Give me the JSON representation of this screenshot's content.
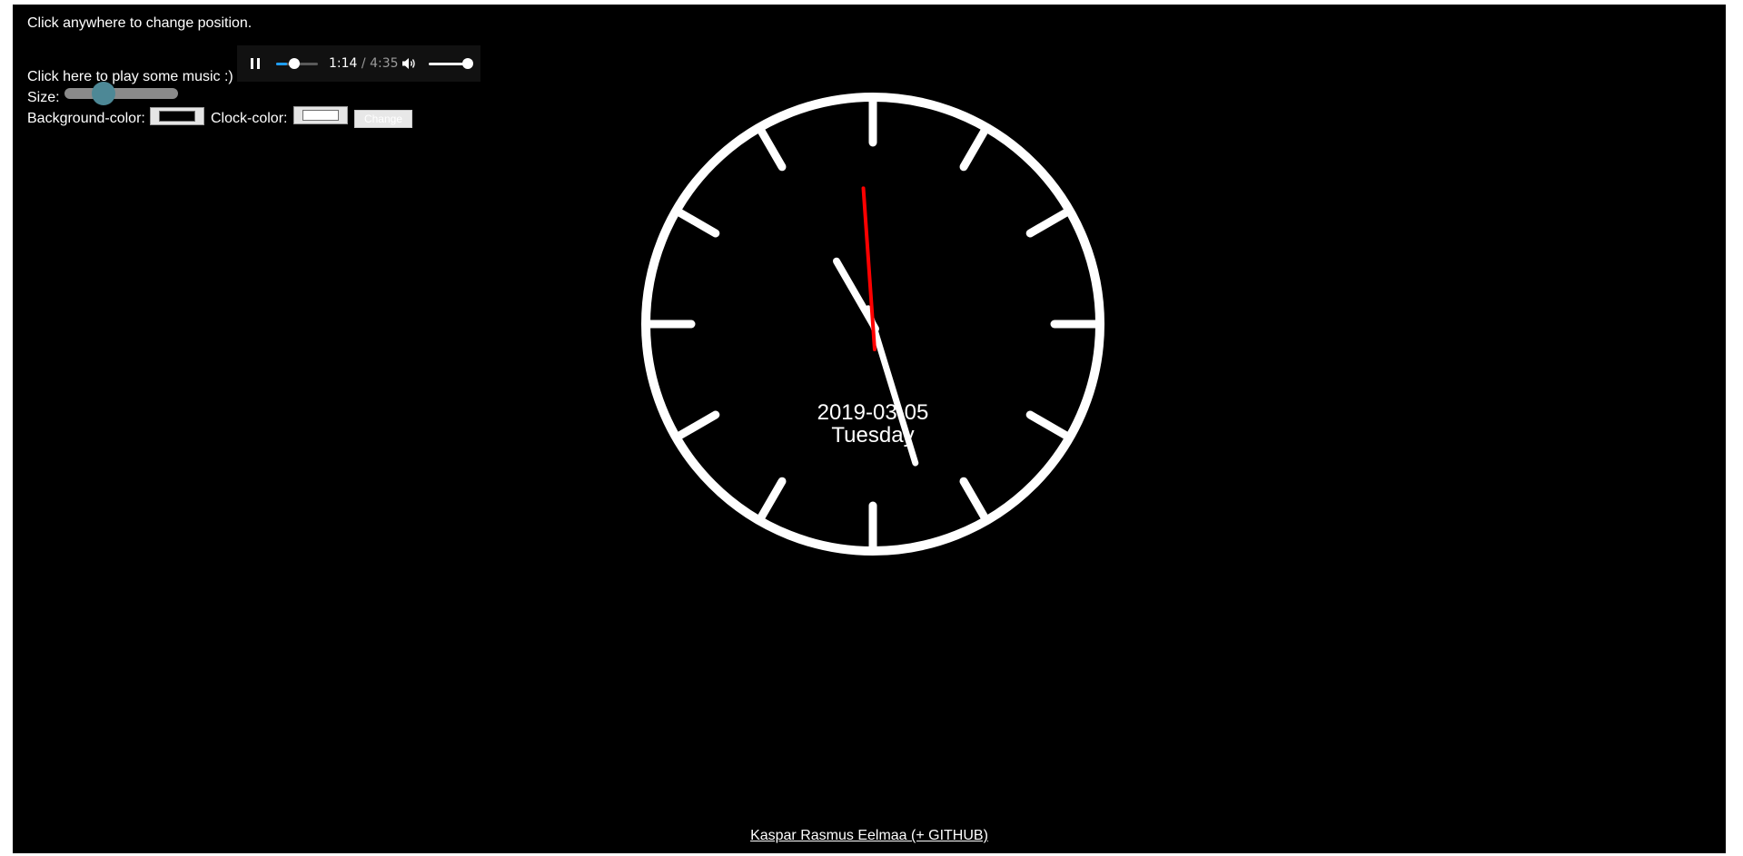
{
  "page": {
    "instruction": "Click anywhere to change position.",
    "music_link": "Click here to play some music :)",
    "size_label": "Size:",
    "size_level": 0.33,
    "background_color_label": "Background-color:",
    "background_color_value": "#000000",
    "clock_color_label": "Clock-color:",
    "clock_color_value": "#ffffff",
    "change_button": "Change"
  },
  "audio_player": {
    "state": "playing",
    "pause_icon": "pause-icon",
    "current_time": "1:14",
    "separator": " / ",
    "total_time": "4:35",
    "progress_fraction": 0.27,
    "volume_icon": "speaker-icon",
    "volume_level": 1.0
  },
  "clock": {
    "date": "2019-03-05",
    "weekday": "Tuesday",
    "hour_hand_angle_deg": -30,
    "minute_hand_angle_deg": 163,
    "second_hand_angle_deg": -4,
    "second_hand_color": "#ff0000",
    "face_color": "#ffffff",
    "background_color": "#000000"
  },
  "footer": {
    "link_text": "Kaspar Rasmus Eelmaa (+ GITHUB)"
  }
}
